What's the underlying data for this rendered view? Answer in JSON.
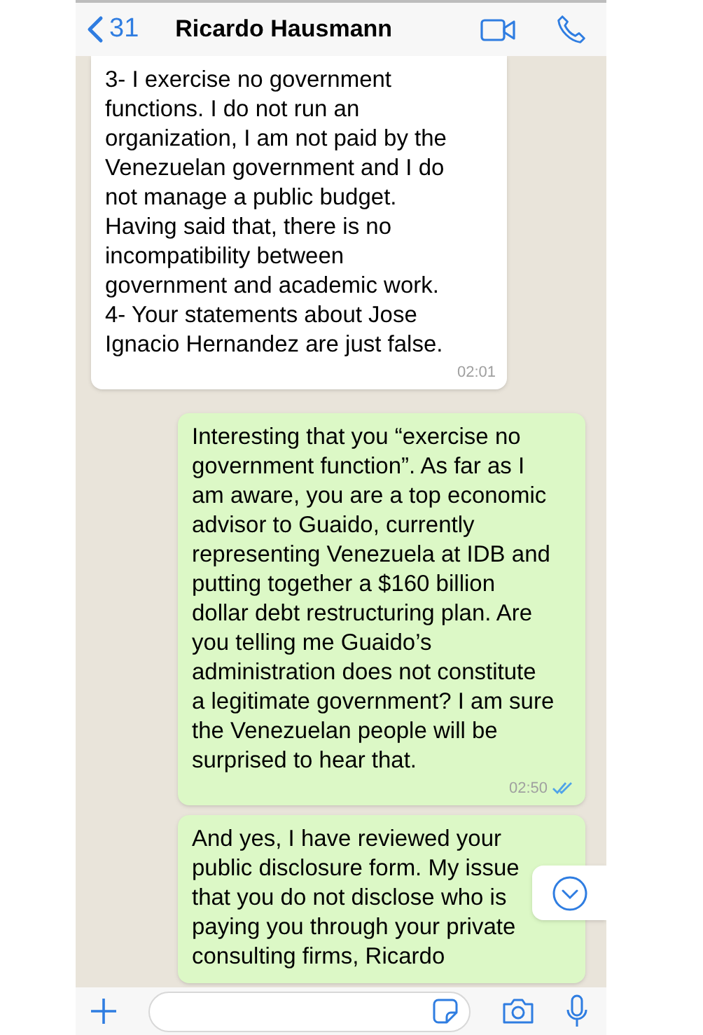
{
  "header": {
    "back_count": "31",
    "contact": "Ricardo Hausmann"
  },
  "messages": [
    {
      "kind": "incoming",
      "text": "3- I exercise no government\nfunctions. I do not run an\norganization, I am not paid by the\nVenezuelan government and I do\nnot manage a public budget.\nHaving said that, there is no\nincompatibility between\ngovernment and academic work.\n4- Your statements about Jose\nIgnacio Hernandez are just false.",
      "time": "02:01"
    },
    {
      "kind": "outgoing",
      "text": "Interesting that you “exercise no\ngovernment function”. As far as I\nam aware, you are a top economic\nadvisor to Guaido, currently\nrepresenting Venezuela at IDB and\nputting together a $160 billion\ndollar debt restructuring plan. Are\nyou telling me Guaido’s\nadministration does not constitute\na legitimate government? I am sure\nthe Venezuelan people will be\nsurprised to hear that.",
      "time": "02:50",
      "read": true
    },
    {
      "kind": "outgoing",
      "text": "And yes, I have reviewed your\npublic disclosure form. My issue\nthat you do not disclose who is\npaying you through your private\nconsulting firms, Ricardo"
    }
  ]
}
